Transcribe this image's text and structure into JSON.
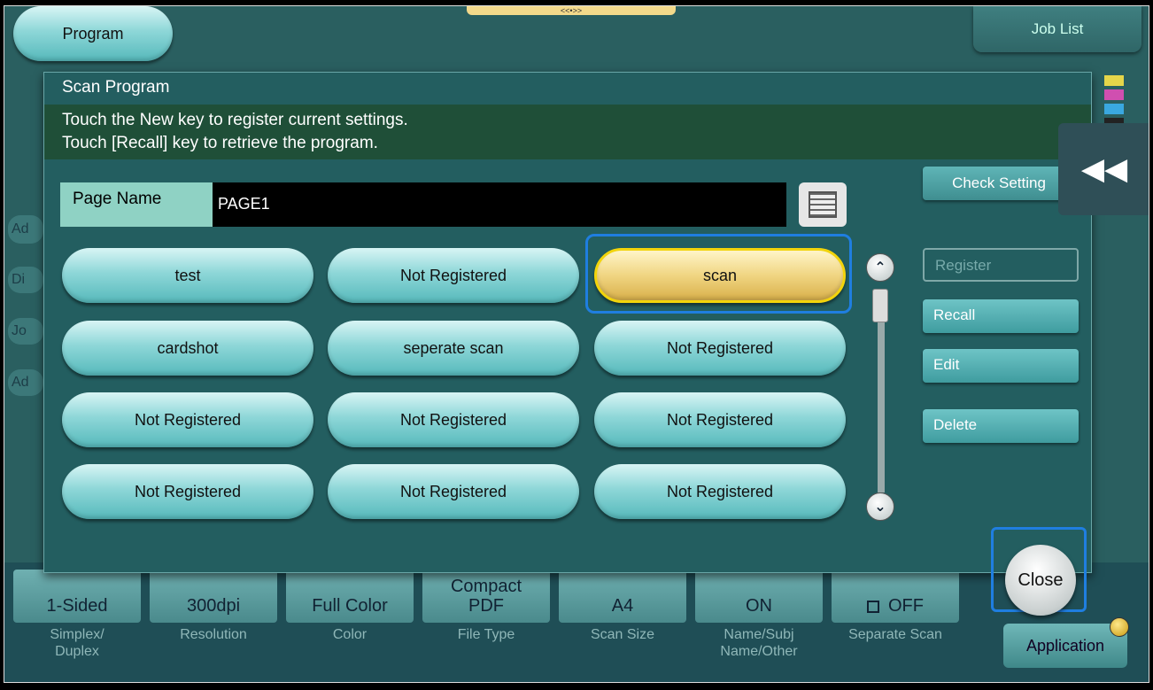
{
  "header": {
    "program_tab": "Program",
    "job_list_tab": "Job List",
    "handle_glyph": "<<•>>"
  },
  "dialog": {
    "title": "Scan Program",
    "message_line1": "Touch the New key to register current settings.",
    "message_line2": "Touch [Recall] key to retrieve the program.",
    "page_name_label": "Page Name",
    "page_name_value": "PAGE1",
    "programs": [
      "test",
      "Not Registered",
      "scan",
      "cardshot",
      "seperate scan",
      "Not Registered",
      "Not Registered",
      "Not Registered",
      "Not Registered",
      "Not Registered",
      "Not Registered",
      "Not Registered"
    ],
    "selected_program": "scan",
    "buttons": {
      "check_setting": "Check Setting",
      "register": "Register",
      "recall": "Recall",
      "edit": "Edit",
      "delete": "Delete",
      "close": "Close"
    }
  },
  "bottom_settings": [
    {
      "value": "1-Sided",
      "label": "Simplex/\nDuplex"
    },
    {
      "value": "300dpi",
      "label": "Resolution"
    },
    {
      "value": "Full Color",
      "label": "Color"
    },
    {
      "value": "Compact\nPDF",
      "label": "File Type"
    },
    {
      "value": "A4",
      "label": "Scan Size"
    },
    {
      "value": "ON",
      "label": "Name/Subj\nName/Other"
    },
    {
      "value": "OFF",
      "label": "Separate Scan"
    }
  ],
  "application_button": "Application",
  "background_left_labels": [
    "Ad",
    "Di",
    "Jo",
    "Ad"
  ],
  "colors": {
    "accent_selected": "#f2d40b",
    "focus_outline": "#1f7ee0",
    "dialog_bg": "#235e60"
  }
}
